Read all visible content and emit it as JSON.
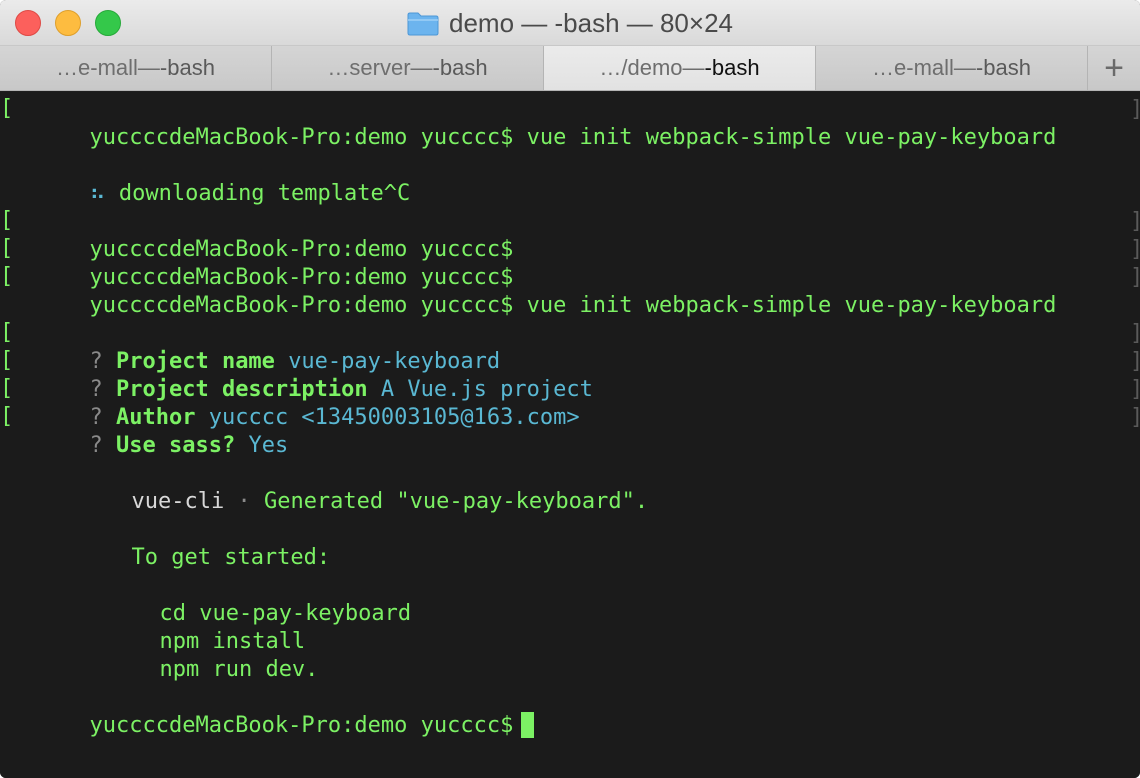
{
  "window": {
    "title": "demo — -bash — 80×24"
  },
  "tabs": [
    {
      "path": "…e-mall",
      "sep": " — ",
      "cmd": "-bash",
      "active": false
    },
    {
      "path": "…server",
      "sep": " — ",
      "cmd": "-bash",
      "active": false
    },
    {
      "path": "…/demo",
      "sep": " — ",
      "cmd": "-bash",
      "active": true
    },
    {
      "path": "…e-mall",
      "sep": " — ",
      "cmd": "-bash",
      "active": false
    }
  ],
  "tab_add_label": "+",
  "terminal": {
    "prompt": "yuccccdeMacBook-Pro:demo yucccc$",
    "cmd_vue_init": "vue init webpack-simple vue-pay-keyboard",
    "spinner": "⠦",
    "downloading": "downloading template^C",
    "q_mark": "?",
    "project_name_label": "Project name",
    "project_name_value": "vue-pay-keyboard",
    "project_desc_label": "Project description",
    "project_desc_value": "A Vue.js project",
    "author_label": "Author",
    "author_value": "yucccc <13450003105@163.com>",
    "sass_label": "Use sass?",
    "sass_value": "Yes",
    "vuecli": "vue-cli",
    "vuecli_dot": "·",
    "generated": "Generated \"vue-pay-keyboard\".",
    "to_get_started": "To get started:",
    "step1": "cd vue-pay-keyboard",
    "step2": "npm install",
    "step3": "npm run dev."
  },
  "colors": {
    "terminal_bg": "#1b1b1b",
    "text_green": "#7cf164",
    "text_cyan": "#5ab8d3",
    "text_white": "#d8d8d8"
  }
}
